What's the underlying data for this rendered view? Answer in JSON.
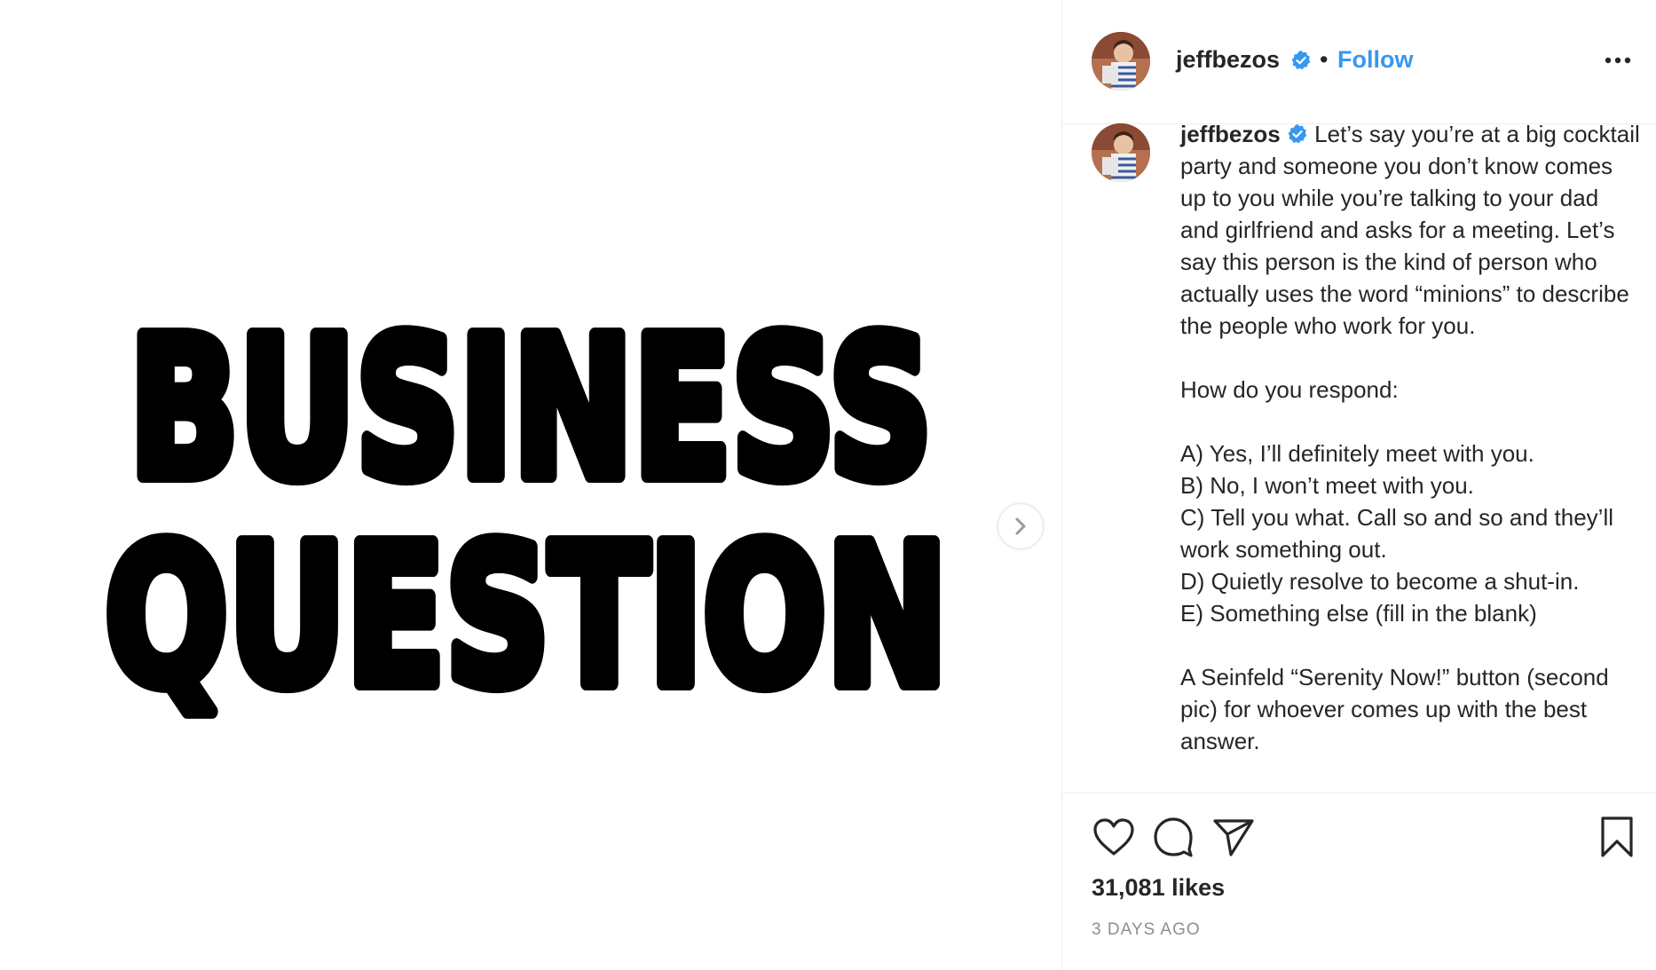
{
  "media": {
    "line1": "BUSINESS",
    "line2": "QUESTION",
    "next_icon": "chevron-right-icon"
  },
  "post": {
    "username": "jeffbezos",
    "separator": "•",
    "follow_label": "Follow",
    "more_icon": "more-options-icon",
    "verified_icon": "verified-badge-icon",
    "accent_color": "#3897f0"
  },
  "caption": {
    "username": "jeffbezos",
    "paragraph1": "Let’s say you’re at a big cocktail party and someone you don’t know comes up to you while you’re talking to your dad and girlfriend and asks for a meeting. Let’s say this person is the kind of person who actually uses the word “minions” to describe the people who work for you.",
    "paragraph2": "How do you respond:",
    "options": [
      "A) Yes, I’ll definitely meet with you.",
      "B) No, I won’t meet with you.",
      "C) Tell you what. Call so and so and they’ll work something out.",
      "D) Quietly resolve to become a shut-in.",
      "E) Something else (fill in the blank)"
    ],
    "paragraph3": "A Seinfeld “Serenity Now!” button (second pic) for whoever comes up with the best answer."
  },
  "actions": {
    "like_icon": "heart-icon",
    "comment_icon": "comment-icon",
    "share_icon": "share-icon",
    "save_icon": "bookmark-icon"
  },
  "likes": "31,081 likes",
  "timestamp": "3 DAYS AGO"
}
